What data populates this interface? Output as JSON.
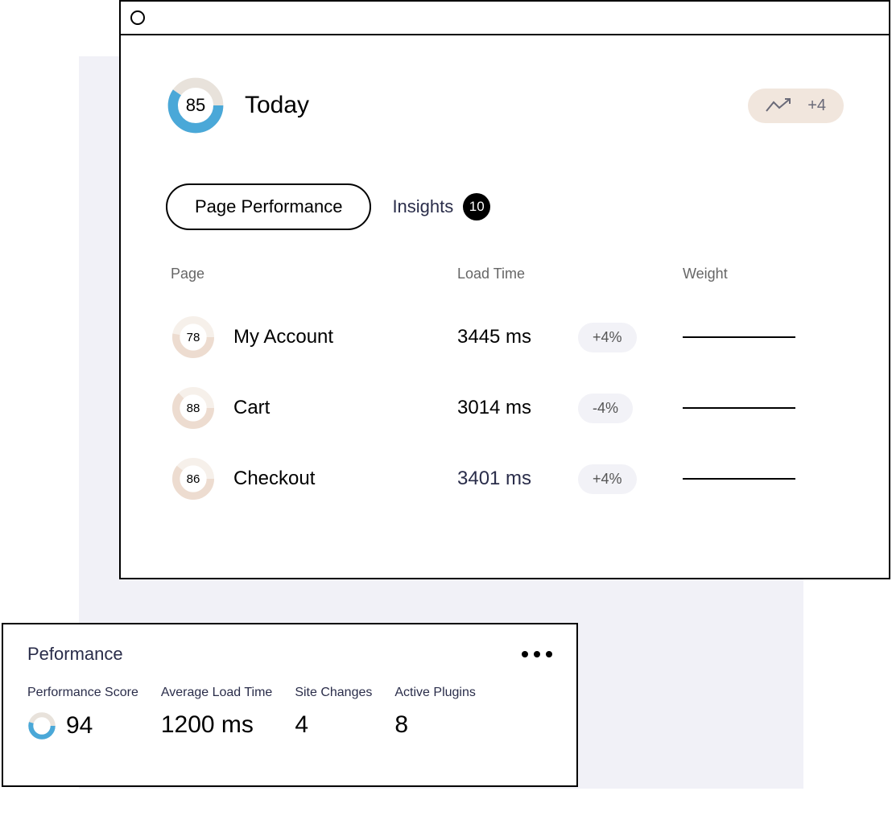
{
  "header": {
    "score": 85,
    "title": "Today",
    "trend_delta": "+4"
  },
  "tabs": {
    "active_label": "Page Performance",
    "insights_label": "Insights",
    "insights_count": 10
  },
  "table": {
    "columns": {
      "page": "Page",
      "load": "Load Time",
      "weight": "Weight"
    },
    "rows": [
      {
        "score": 78,
        "name": "My Account",
        "load": "3445 ms",
        "delta": "+4%",
        "accent": false
      },
      {
        "score": 88,
        "name": "Cart",
        "load": "3014 ms",
        "delta": "-4%",
        "accent": false
      },
      {
        "score": 86,
        "name": "Checkout",
        "load": "3401 ms",
        "delta": "+4%",
        "accent": true
      }
    ]
  },
  "summary": {
    "title": "Peformance",
    "cols": [
      {
        "label": "Performance Score",
        "value": "94"
      },
      {
        "label": "Average Load Time",
        "value": "1200 ms"
      },
      {
        "label": "Site Changes",
        "value": "4"
      },
      {
        "label": "Active Plugins",
        "value": "8"
      }
    ]
  },
  "colors": {
    "donut_main": "#4aa8d8",
    "donut_track": "#e8e2db",
    "donut_sm": "#eddcd0"
  }
}
